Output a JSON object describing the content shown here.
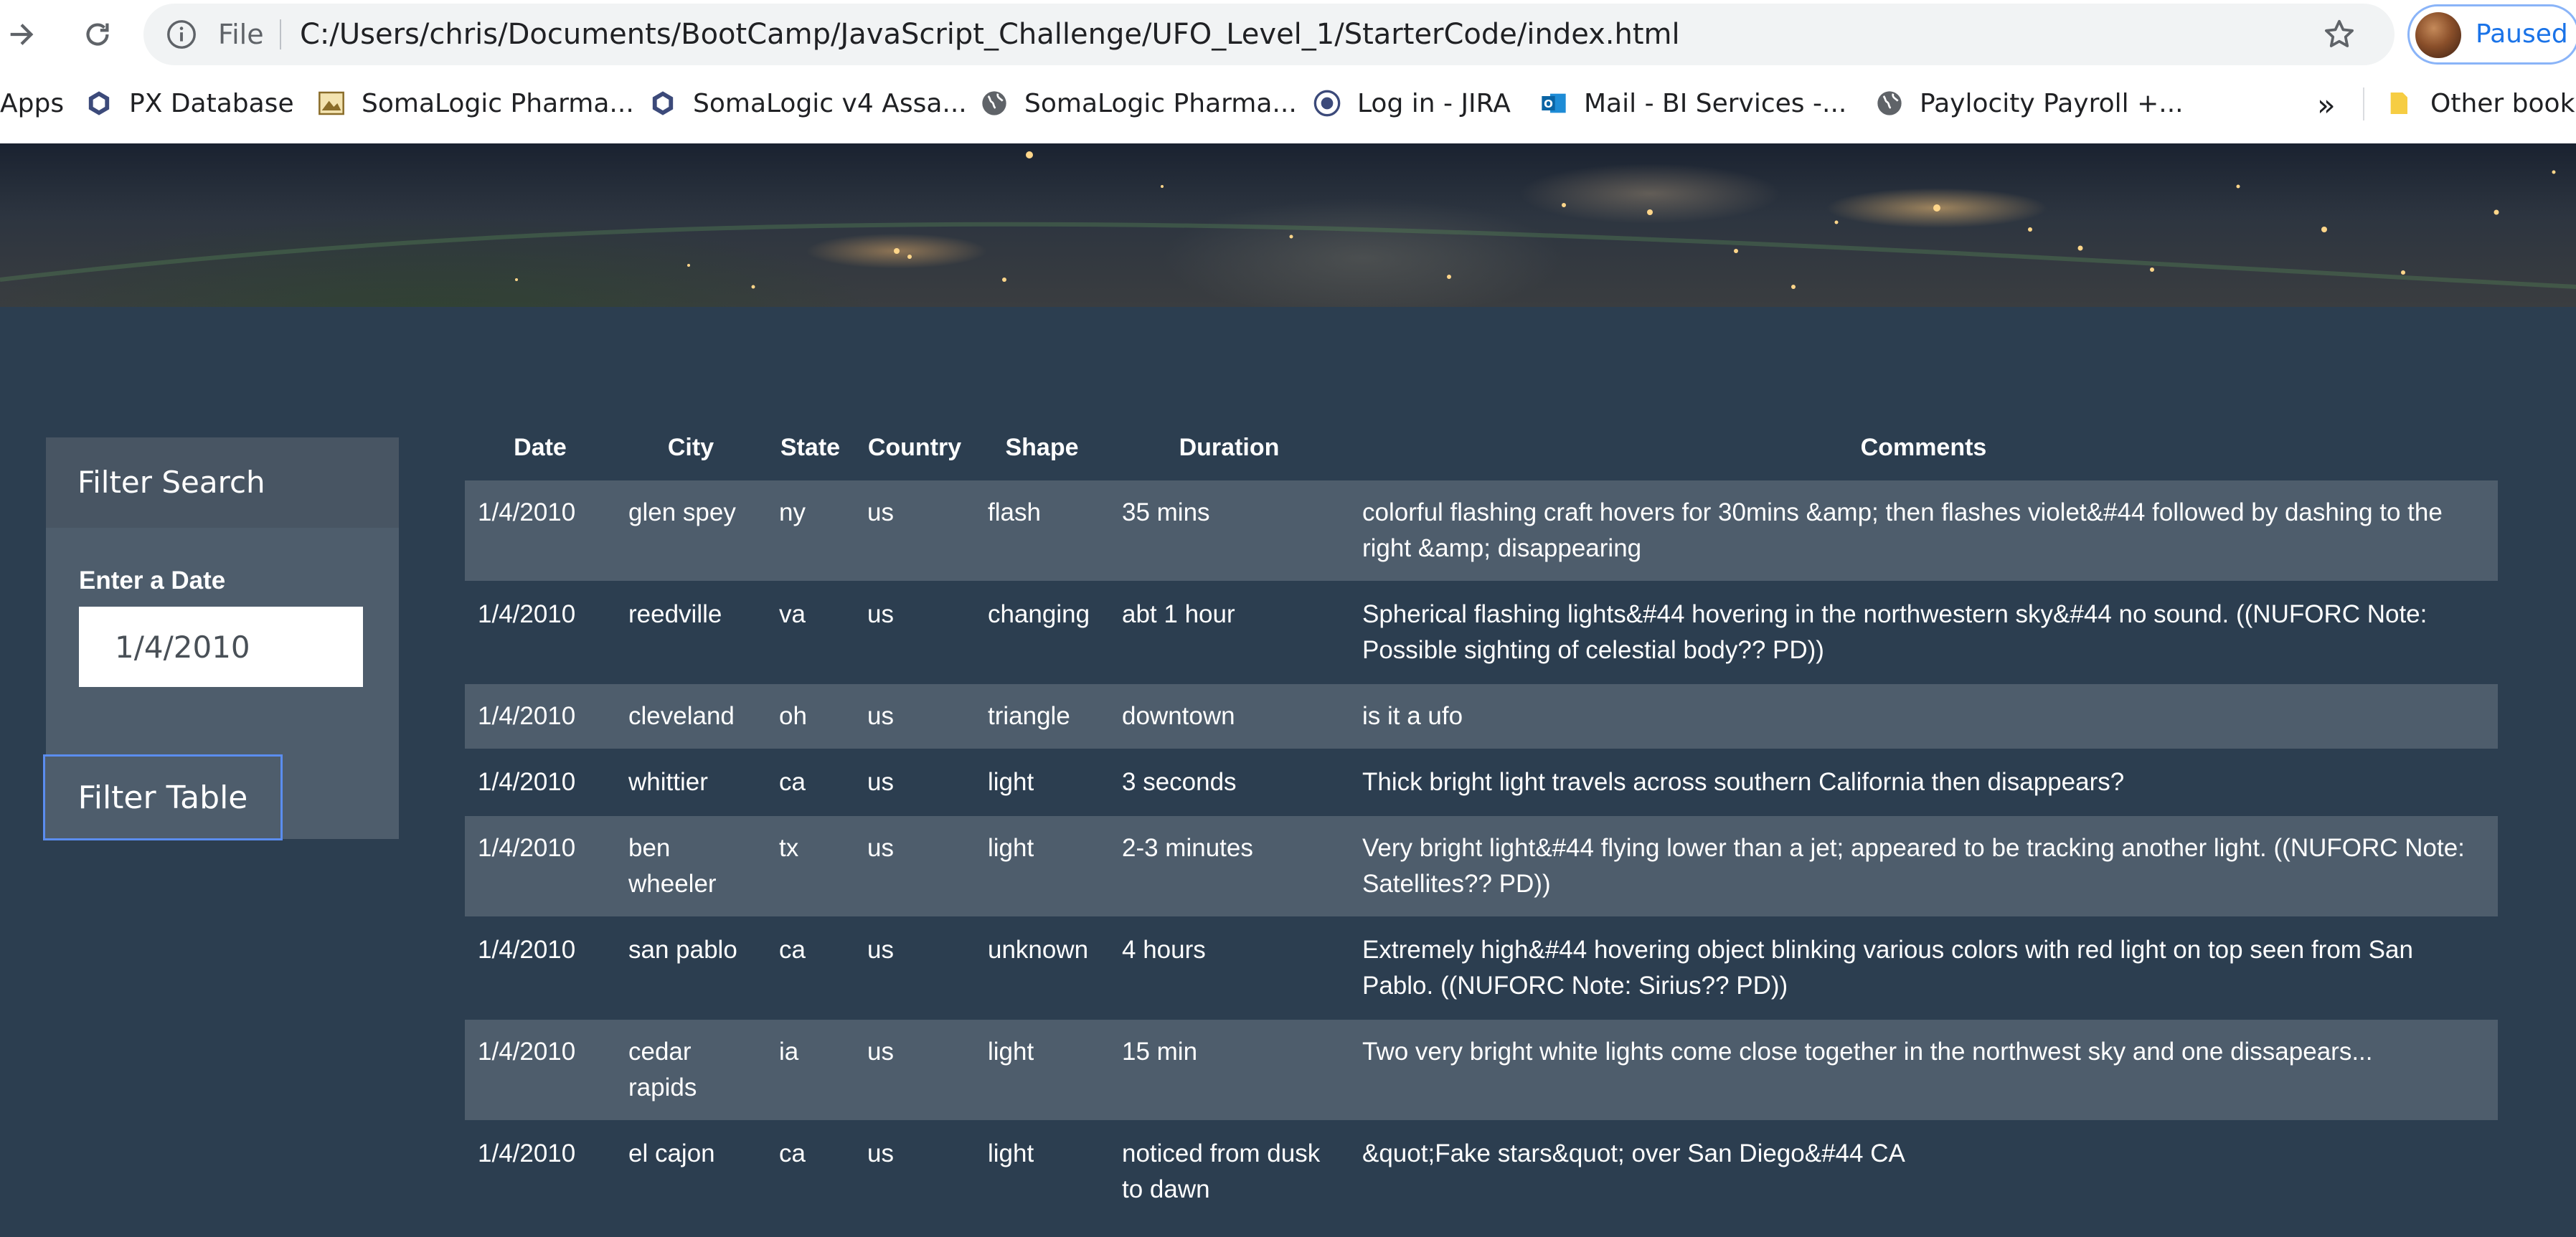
{
  "browser": {
    "scheme_label": "File",
    "url": "C:/Users/chris/Documents/BootCamp/JavaScript_Challenge/UFO_Level_1/StarterCode/index.html",
    "profile_status": "Paused",
    "accent_color": "#1a73e8",
    "bookmarks": [
      {
        "label": "Apps",
        "icon": "apps-grid-icon"
      },
      {
        "label": "PX Database",
        "icon": "hexagon-icon"
      },
      {
        "label": "SomaLogic Pharma...",
        "icon": "site-image-icon"
      },
      {
        "label": "SomaLogic v4 Assa...",
        "icon": "hexagon-icon"
      },
      {
        "label": "SomaLogic Pharma...",
        "icon": "globe-icon"
      },
      {
        "label": "Log in - JIRA",
        "icon": "jira-icon"
      },
      {
        "label": "Mail - BI Services -...",
        "icon": "outlook-icon"
      },
      {
        "label": "Paylocity Payroll +...",
        "icon": "globe-icon"
      }
    ],
    "overflow_label": "»",
    "other_bookmarks_label": "Other bookn"
  },
  "filter": {
    "heading": "Filter Search",
    "date_label": "Enter a Date",
    "date_value": "1/4/2010",
    "button_label": "Filter Table"
  },
  "table": {
    "headers": [
      "Date",
      "City",
      "State",
      "Country",
      "Shape",
      "Duration",
      "Comments"
    ],
    "rows": [
      [
        "1/4/2010",
        "glen spey",
        "ny",
        "us",
        "flash",
        "35 mins",
        "colorful flashing craft hovers for 30mins &amp; then flashes violet&#44 followed by dashing to the right &amp; disappearing"
      ],
      [
        "1/4/2010",
        "reedville",
        "va",
        "us",
        "changing",
        "abt 1 hour",
        "Spherical flashing lights&#44 hovering in the northwestern sky&#44 no sound. ((NUFORC Note: Possible sighting of celestial body?? PD))"
      ],
      [
        "1/4/2010",
        "cleveland",
        "oh",
        "us",
        "triangle",
        "downtown",
        "is it a ufo"
      ],
      [
        "1/4/2010",
        "whittier",
        "ca",
        "us",
        "light",
        "3 seconds",
        "Thick bright light travels across southern California then disappears?"
      ],
      [
        "1/4/2010",
        "ben wheeler",
        "tx",
        "us",
        "light",
        "2-3 minutes",
        "Very bright light&#44 flying lower than a jet; appeared to be tracking another light. ((NUFORC Note: Satellites?? PD))"
      ],
      [
        "1/4/2010",
        "san pablo",
        "ca",
        "us",
        "unknown",
        "4 hours",
        "Extremely high&#44 hovering object blinking various colors with red light on top seen from San Pablo. ((NUFORC Note: Sirius?? PD))"
      ],
      [
        "1/4/2010",
        "cedar rapids",
        "ia",
        "us",
        "light",
        "15 min",
        "Two very bright white lights come close together in the northwest sky and one dissapears..."
      ],
      [
        "1/4/2010",
        "el cajon",
        "ca",
        "us",
        "light",
        "noticed from dusk to dawn",
        "&quot;Fake stars&quot; over San Diego&#44 CA"
      ]
    ]
  },
  "colors": {
    "page_background": "#2c3e50",
    "panel_background": "#4e5d6c",
    "row_stripe": "#4e5d6c",
    "button_border": "#5b8def"
  }
}
